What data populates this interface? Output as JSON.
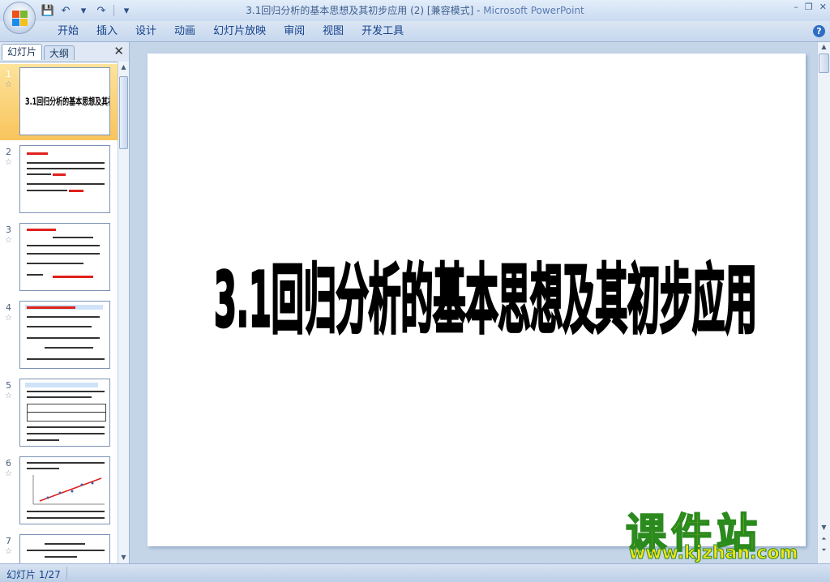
{
  "window": {
    "title": "3.1回归分析的基本思想及其初步应用 (2) [兼容模式] - ",
    "app_name": "Microsoft PowerPoint",
    "controls": [
      "–",
      "❐",
      "✕"
    ]
  },
  "quick_access": [
    {
      "name": "save-icon",
      "glyph": "💾"
    },
    {
      "name": "undo-icon",
      "glyph": "↶"
    },
    {
      "name": "undo-dropdown-icon",
      "glyph": "▾"
    },
    {
      "name": "redo-icon",
      "glyph": "↷"
    },
    {
      "name": "customize-qat-icon",
      "glyph": "▾"
    }
  ],
  "ribbon": {
    "tabs": [
      "开始",
      "插入",
      "设计",
      "动画",
      "幻灯片放映",
      "审阅",
      "视图",
      "开发工具"
    ],
    "help": "?"
  },
  "panel": {
    "tabs": [
      "幻灯片",
      "大纲"
    ],
    "close": "✕",
    "slides": [
      {
        "num": "1",
        "star": "☆",
        "label": "3.1回归分析的基本思想及其初步应用"
      },
      {
        "num": "2",
        "star": "☆"
      },
      {
        "num": "3",
        "star": "☆"
      },
      {
        "num": "4",
        "star": "☆"
      },
      {
        "num": "5",
        "star": "☆"
      },
      {
        "num": "6",
        "star": "☆"
      },
      {
        "num": "7",
        "star": "☆"
      }
    ]
  },
  "slide": {
    "title": "3.1回归分析的基本思想及其初步应用"
  },
  "status": {
    "slide_indicator": "幻灯片 1/27"
  },
  "watermark": {
    "title": "课件站",
    "url": "www.kjzhan.com"
  },
  "colors": {
    "accent": "#15428b",
    "selected_thumb": "#f9c45c",
    "watermark_fill": "#f5e21c",
    "watermark_stroke": "#2b8a1e"
  }
}
